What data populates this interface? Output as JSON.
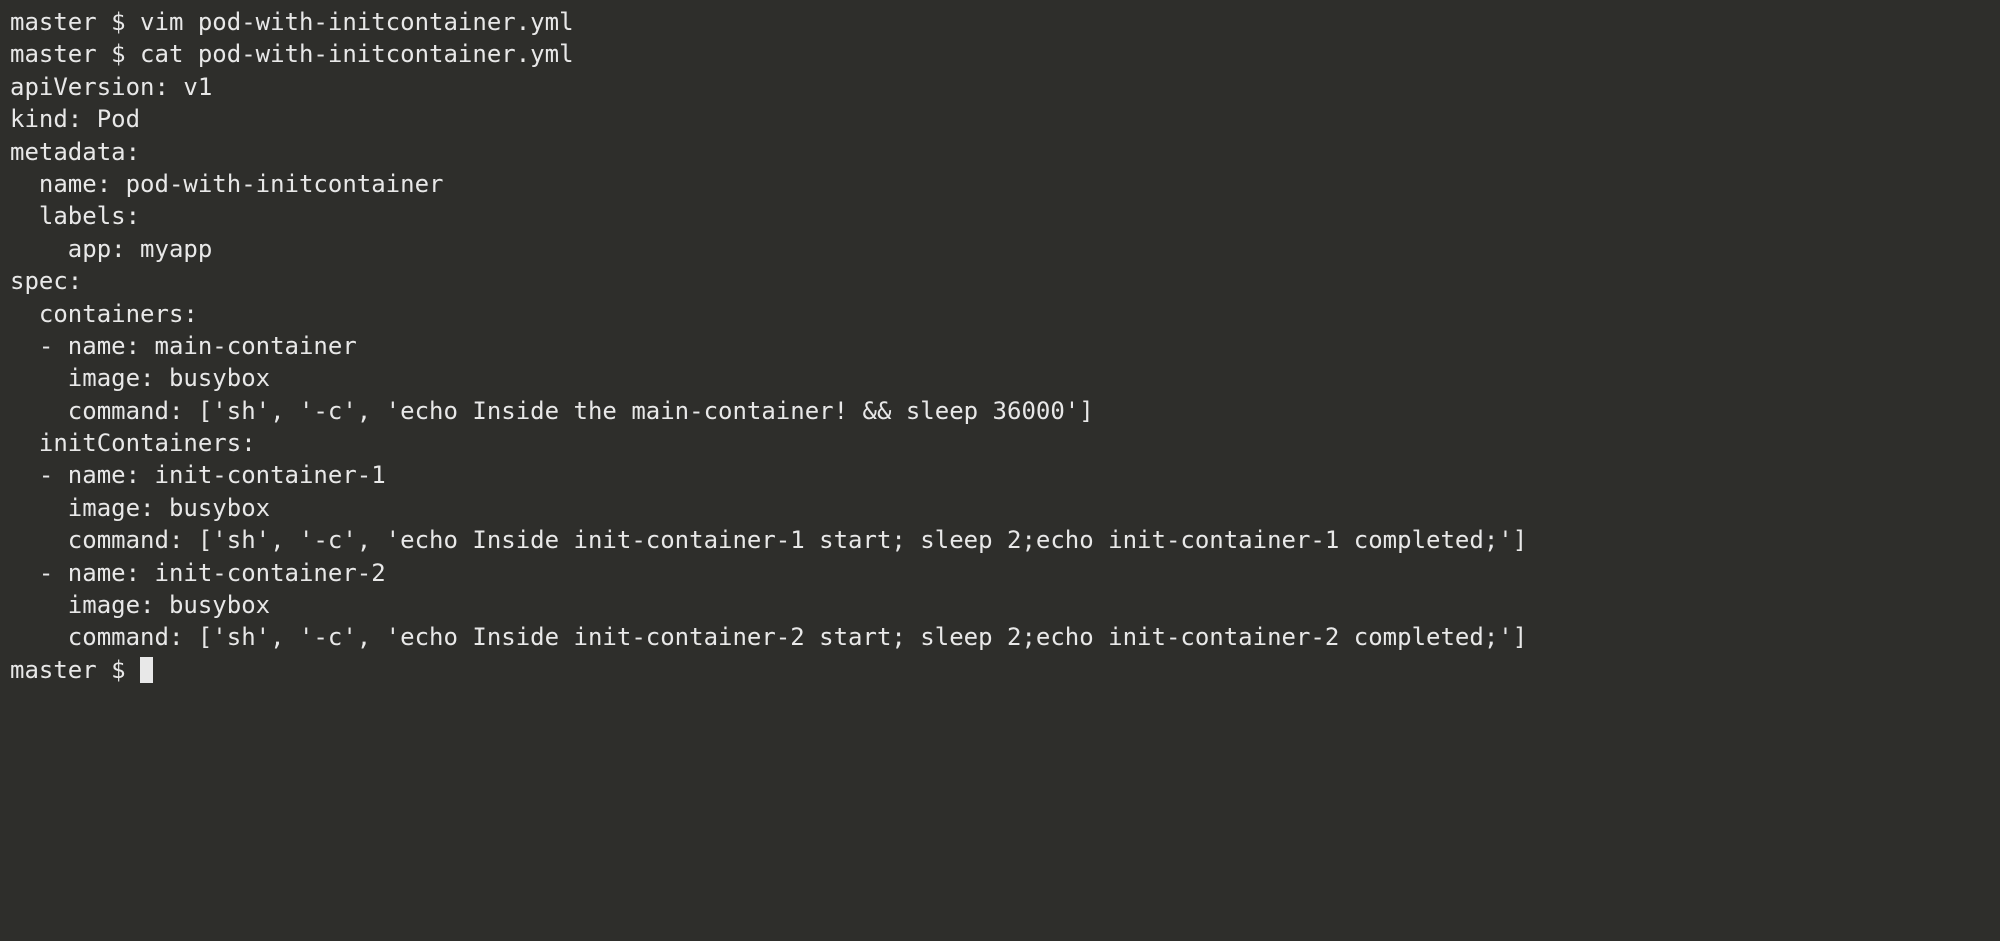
{
  "terminal": {
    "prompt_host": "master",
    "prompt_symbol": "$",
    "lines": [
      "master $ vim pod-with-initcontainer.yml",
      "master $ cat pod-with-initcontainer.yml",
      "apiVersion: v1",
      "kind: Pod",
      "metadata:",
      "  name: pod-with-initcontainer",
      "  labels:",
      "    app: myapp",
      "spec:",
      "  containers:",
      "  - name: main-container",
      "    image: busybox",
      "    command: ['sh', '-c', 'echo Inside the main-container! && sleep 36000']",
      "  initContainers:",
      "  - name: init-container-1",
      "    image: busybox",
      "    command: ['sh', '-c', 'echo Inside init-container-1 start; sleep 2;echo init-container-1 completed;']",
      "  - name: init-container-2",
      "    image: busybox",
      "    command: ['sh', '-c', 'echo Inside init-container-2 start; sleep 2;echo init-container-2 completed;']"
    ],
    "current_prompt": "master $ "
  }
}
